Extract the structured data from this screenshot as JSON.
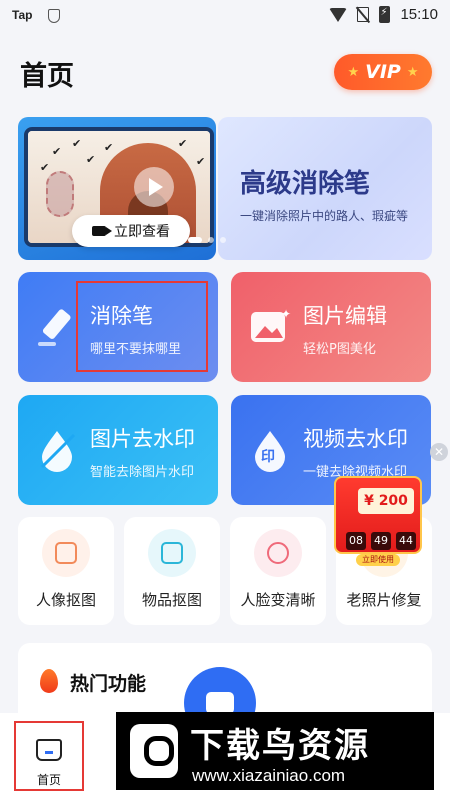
{
  "status_bar": {
    "carrier": "Tap",
    "time": "15:10"
  },
  "header": {
    "title": "首页",
    "vip_label": "VIP"
  },
  "banner": {
    "watch_button": "立即查看",
    "promo_title": "高级消除笔",
    "promo_subtitle": "一键消除照片中的路人、瑕疵等"
  },
  "features": [
    {
      "title": "消除笔",
      "desc": "哪里不要抹哪里"
    },
    {
      "title": "图片编辑",
      "desc": "轻松P图美化"
    },
    {
      "title": "图片去水印",
      "desc": "智能去除图片水印"
    },
    {
      "title": "视频去水印",
      "desc": "一键去除视频水印"
    }
  ],
  "tools": [
    {
      "label": "人像抠图"
    },
    {
      "label": "物品抠图"
    },
    {
      "label": "人脸变清晰"
    },
    {
      "label": "老照片修复"
    }
  ],
  "coupon": {
    "amount": "¥ 200",
    "hours": "08",
    "minutes": "49",
    "seconds": "44",
    "tag": "立即使用"
  },
  "hot_section": {
    "title": "热门功能"
  },
  "bottom_nav": {
    "home_label": "首页"
  },
  "watermark": {
    "brand": "下载鸟资源",
    "url": "www.xiazainiao.com"
  },
  "colors": {
    "accent": "#2f6df3",
    "vip": "#ff5a2a",
    "highlight": "#e53935"
  }
}
